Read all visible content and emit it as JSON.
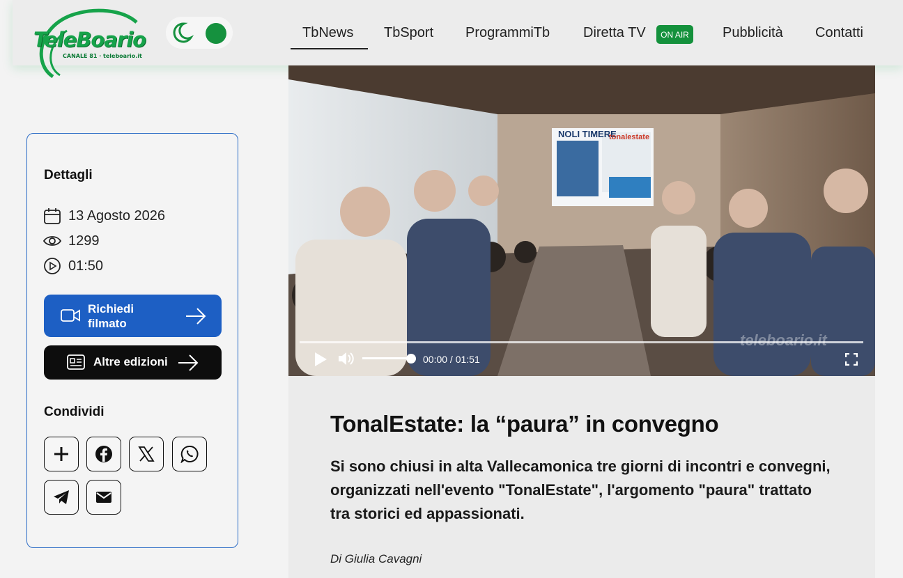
{
  "brand": {
    "name": "TeleBoario",
    "tagline": "CANALE 81 · teleboario.it"
  },
  "nav": {
    "items": [
      "TbNews",
      "TbSport",
      "ProgrammiTb",
      "Diretta TV",
      "Pubblicità",
      "Contatti"
    ],
    "active": "TbNews",
    "onair_badge": "ON AIR"
  },
  "sidebar": {
    "details_title": "Dettagli",
    "date": "13 Agosto 2026",
    "views": "1299",
    "duration": "01:50",
    "request_button": "Richiedi filmato",
    "editions_button": "Altre edizioni",
    "share_title": "Condividi",
    "share_icons": [
      "plus-icon",
      "facebook-icon",
      "x-icon",
      "whatsapp-icon",
      "telegram-icon",
      "mail-icon"
    ]
  },
  "video": {
    "time_display": "00:00 / 01:51",
    "watermark": "teleboario.it",
    "progress": 0,
    "volume": 1,
    "poster_banner": "NOLI TIMERE",
    "poster_brand": "tonalestate"
  },
  "article": {
    "title": "TonalEstate: la “paura” in convegno",
    "subtitle": "Si sono chiusi in alta Vallecamonica tre giorni di incontri e convegni, organizzati nell'evento \"TonalEstate\", l'argomento \"paura\" trattato tra storici ed appassionati.",
    "author": "Di Giulia Cavagni"
  },
  "colors": {
    "accent_green": "#15913e",
    "button_blue": "#1d5fc4",
    "card_border": "#2a6bc6"
  }
}
